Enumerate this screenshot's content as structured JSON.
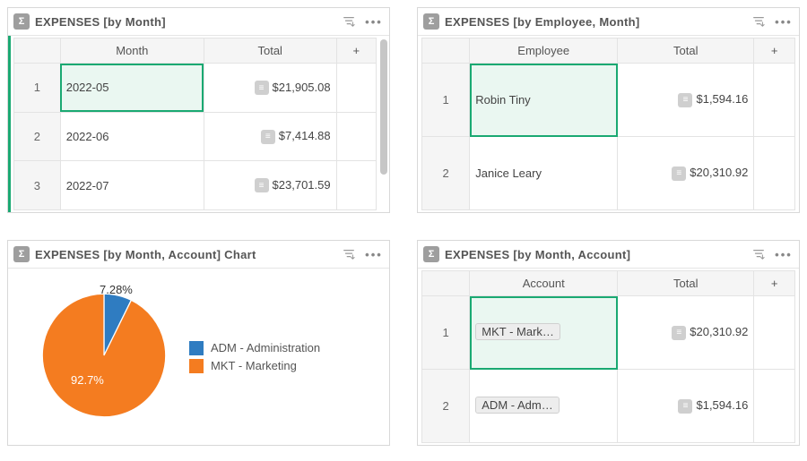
{
  "cards": {
    "month": {
      "title": "EXPENSES [by Month]",
      "columns": {
        "main": "Month",
        "total": "Total",
        "plus": "+"
      },
      "rows": [
        {
          "n": "1",
          "main": "2022-05",
          "total": "$21,905.08",
          "selected": true
        },
        {
          "n": "2",
          "main": "2022-06",
          "total": "$7,414.88"
        },
        {
          "n": "3",
          "main": "2022-07",
          "total": "$23,701.59"
        }
      ]
    },
    "employee": {
      "title": "EXPENSES [by Employee, Month]",
      "columns": {
        "main": "Employee",
        "total": "Total",
        "plus": "+"
      },
      "rows": [
        {
          "n": "1",
          "main": "Robin Tiny",
          "total": "$1,594.16",
          "selected": true
        },
        {
          "n": "2",
          "main": "Janice Leary",
          "total": "$20,310.92"
        }
      ]
    },
    "chart": {
      "title": "EXPENSES [by Month, Account] Chart"
    },
    "account": {
      "title": "EXPENSES [by Month, Account]",
      "columns": {
        "main": "Account",
        "total": "Total",
        "plus": "+"
      },
      "rows": [
        {
          "n": "1",
          "chip": "MKT - Mark…",
          "total": "$20,310.92",
          "selected": true
        },
        {
          "n": "2",
          "chip": "ADM - Adm…",
          "total": "$1,594.16"
        }
      ]
    }
  },
  "chart_data": {
    "type": "pie",
    "title": "EXPENSES [by Month, Account] Chart",
    "series": [
      {
        "name": "ADM - Administration",
        "value": 7.28,
        "label": "7.28%",
        "color": "#2f7cc1"
      },
      {
        "name": "MKT - Marketing",
        "value": 92.7,
        "label": "92.7%",
        "color": "#f47c20"
      }
    ]
  },
  "icons": {
    "sigma": "Σ",
    "row": "≡",
    "filter": "⇵",
    "more": "•••"
  }
}
